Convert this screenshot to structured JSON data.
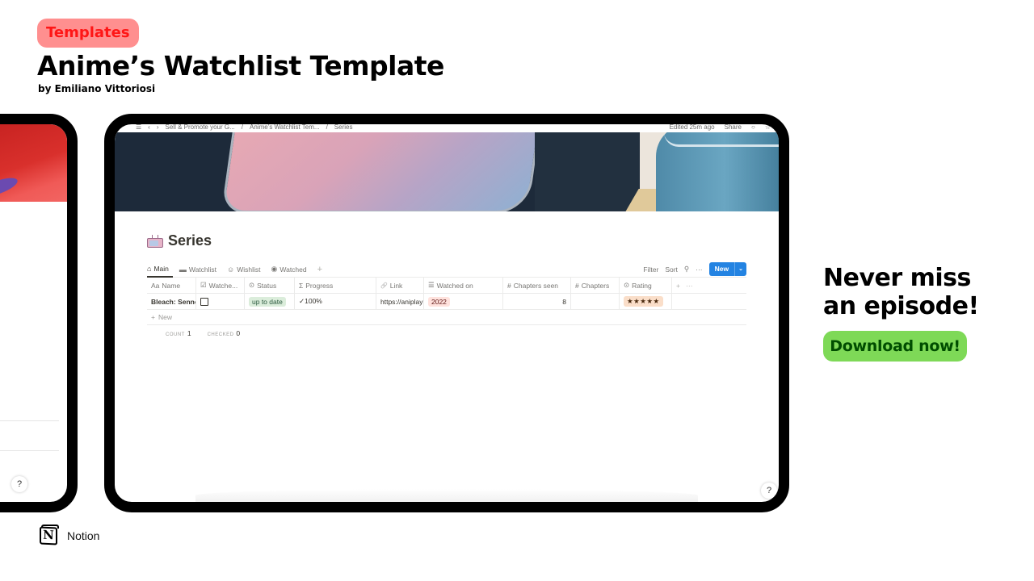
{
  "header": {
    "tag": "Templates",
    "title": "Anime’s Watchlist Template",
    "byline": "by Emiliano Vittoriosi"
  },
  "colors": {
    "tag_bg": "#ff8f8f",
    "tag_text": "#ff1616",
    "download_bg": "#7ed957",
    "download_text": "#004d00",
    "notion_blue": "#2383e2"
  },
  "app": {
    "topbar": {
      "breadcrumbs": [
        "Sell & Promote your G...",
        "Anime’s Watchlist Tem...",
        "Series"
      ],
      "edited": "Edited 25m ago",
      "share": "Share"
    },
    "page_title": "Series",
    "page_icon": "tv-icon",
    "views": [
      {
        "label": "Main",
        "icon": "home-icon",
        "glyph": "⌂",
        "active": true
      },
      {
        "label": "Watchlist",
        "icon": "monitor-icon",
        "glyph": "▬",
        "active": false
      },
      {
        "label": "Wishlist",
        "icon": "smile-icon",
        "glyph": "☺",
        "active": false
      },
      {
        "label": "Watched",
        "icon": "eye-icon",
        "glyph": "◉",
        "active": false
      }
    ],
    "add_view": "+",
    "actions": {
      "filter": "Filter",
      "sort": "Sort",
      "search_glyph": "⚲",
      "more_glyph": "···",
      "new": "New",
      "new_chevron": "⌄"
    },
    "columns": [
      {
        "label": "Name",
        "glyph": "Aa"
      },
      {
        "label": "Watche...",
        "glyph": "☑"
      },
      {
        "label": "Status",
        "glyph": "⊙"
      },
      {
        "label": "Progress",
        "glyph": "Σ"
      },
      {
        "label": "Link",
        "glyph": "🔗"
      },
      {
        "label": "Watched on",
        "glyph": "☰"
      },
      {
        "label": "Chapters seen",
        "glyph": "#"
      },
      {
        "label": "Chapters",
        "glyph": "#"
      },
      {
        "label": "Rating",
        "glyph": "⊙"
      },
      {
        "label": "",
        "glyph": "+   ···"
      }
    ],
    "rows": [
      {
        "name": "Bleach: Senne",
        "watched": false,
        "status": "up to date",
        "progress": "✓100%",
        "link": "https://aniplay",
        "watched_on": "2022",
        "chapters_seen": "8",
        "chapters": "",
        "rating": "★★★★★"
      }
    ],
    "add_row": "New",
    "footer": {
      "count_label": "COUNT",
      "count_value": "1",
      "checked_label": "CHECKED",
      "checked_value": "0"
    },
    "help": "?"
  },
  "promo": {
    "line1": "Never miss",
    "line2": "an episode!",
    "download": "Download now!"
  },
  "brand": {
    "logo_letter": "N",
    "label": "Notion"
  }
}
